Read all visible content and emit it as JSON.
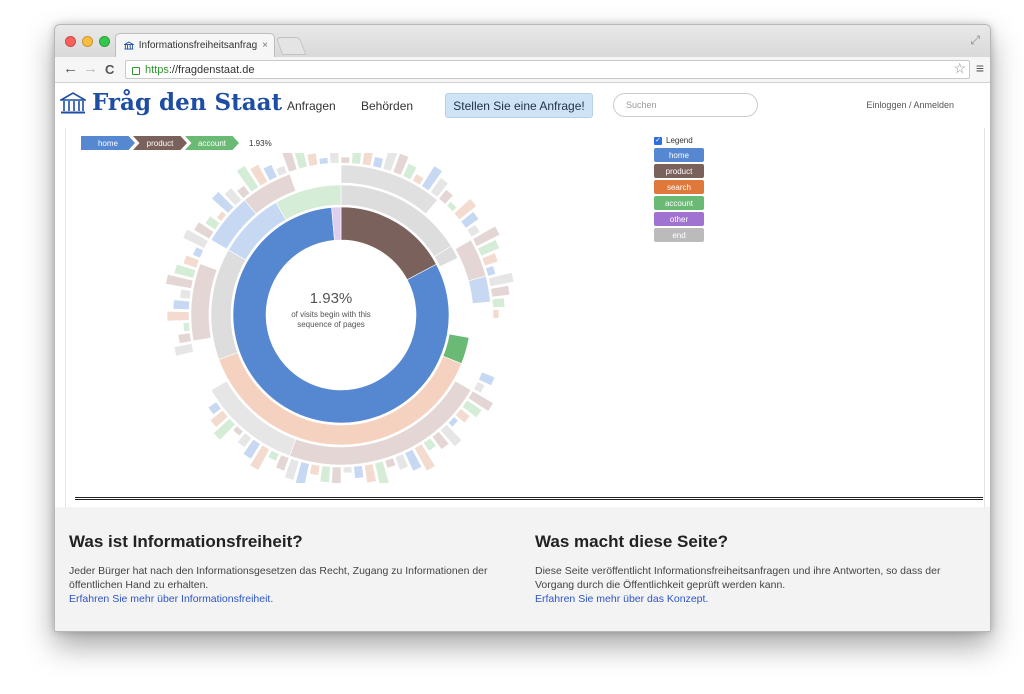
{
  "browser": {
    "tab_title": "Informationsfreiheitsanfrag",
    "tab_close": "×",
    "url_scheme": "https",
    "url_rest": "://fragdenstaat.de",
    "nav": {
      "back": "←",
      "forward": "→",
      "reload": "C"
    }
  },
  "header": {
    "logo_text": "Fråg den Staat",
    "nav": {
      "anfragen": "Anfragen",
      "behoerden": "Behörden"
    },
    "cta": "Stellen Sie eine Anfrage!",
    "search_placeholder": "Suchen",
    "login": "Einloggen / Anmelden"
  },
  "sequence": {
    "breadcrumb": [
      {
        "label": "home",
        "color": "#5687d1"
      },
      {
        "label": "product",
        "color": "#7b615c"
      },
      {
        "label": "account",
        "color": "#6ab975"
      }
    ],
    "breadcrumb_pct": "1.93%",
    "center_pct": "1.93%",
    "center_desc_1": "of visits begin with this",
    "center_desc_2": "sequence of pages",
    "legend_label": "Legend",
    "legend": [
      {
        "label": "home",
        "color": "#5687d1"
      },
      {
        "label": "product",
        "color": "#7b615c"
      },
      {
        "label": "search",
        "color": "#de783b"
      },
      {
        "label": "account",
        "color": "#6ab975"
      },
      {
        "label": "other",
        "color": "#a173d1"
      },
      {
        "label": "end",
        "color": "#bbbbbb"
      }
    ]
  },
  "footer": {
    "left": {
      "title": "Was ist Informationsfreiheit?",
      "text": "Jeder Bürger hat nach den Informationsgesetzen das Recht, Zugang zu Informationen der öffentlichen Hand zu erhalten.",
      "link": "Erfahren Sie mehr über Informationsfreiheit."
    },
    "right": {
      "title": "Was macht diese Seite?",
      "text": "Diese Seite veröffentlicht Informationsfreiheitsanfragen und ihre Antworten, so dass der Vorgang durch die Öffentlichkeit geprüft werden kann.",
      "link": "Erfahren Sie mehr über das Konzept."
    }
  }
}
